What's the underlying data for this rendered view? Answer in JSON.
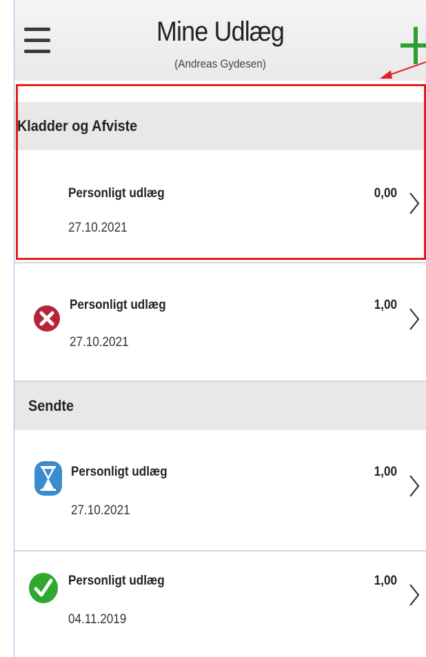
{
  "header": {
    "title": "Mine Udlæg",
    "subtitle": "(Andreas Gydesen)"
  },
  "sections": [
    {
      "title": "Kladder og Afviste",
      "rows": [
        {
          "label": "Personligt udlæg",
          "date": "27.10.2021",
          "amount": "0,00",
          "status": "none"
        },
        {
          "label": "Personligt udlæg",
          "date": "27.10.2021",
          "amount": "1,00",
          "status": "rejected-icon"
        }
      ]
    },
    {
      "title": "Sendte",
      "rows": [
        {
          "label": "Personligt udlæg",
          "date": "27.10.2021",
          "amount": "1,00",
          "status": "pending-hourglass-icon"
        },
        {
          "label": "Personligt udlæg",
          "date": "04.11.2019",
          "amount": "1,00",
          "status": "approved-check-icon"
        }
      ]
    }
  ],
  "colors": {
    "accent_add": "#2e9e2e",
    "rejected": "#b5253a",
    "pending": "#3a8ccf",
    "approved": "#2ea82e",
    "highlight": "#e02020"
  }
}
